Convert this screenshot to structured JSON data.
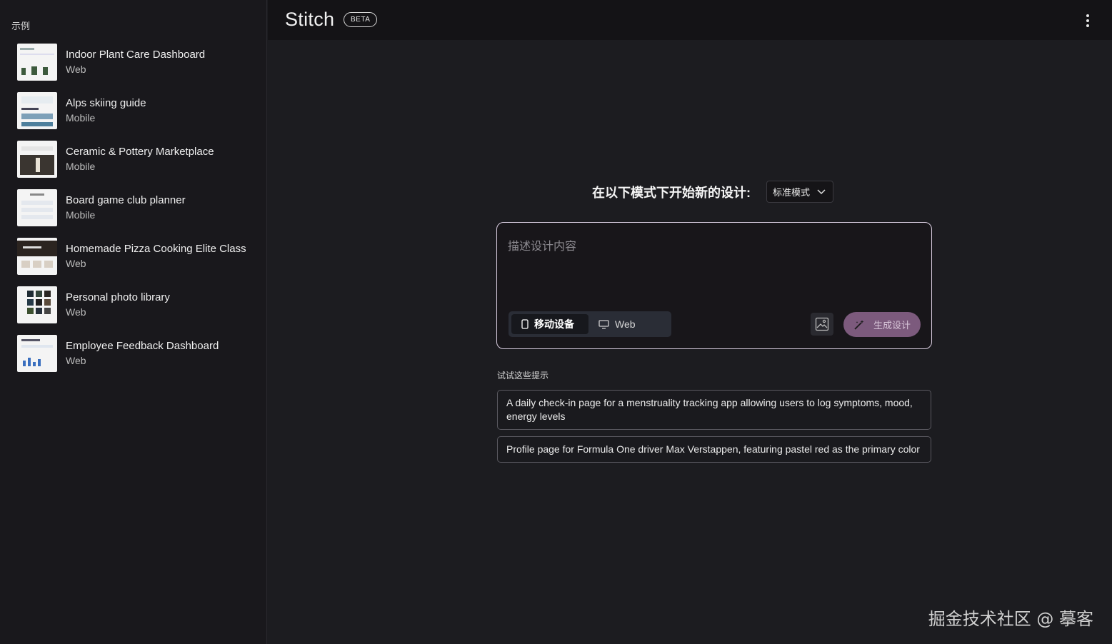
{
  "sidebar": {
    "heading": "示例",
    "items": [
      {
        "title": "Indoor Plant Care Dashboard",
        "type": "Web",
        "thumb": "light-dashboard"
      },
      {
        "title": "Alps skiing guide",
        "type": "Mobile",
        "thumb": "light-mobile"
      },
      {
        "title": "Ceramic & Pottery Marketplace",
        "type": "Mobile",
        "thumb": "dark-hero-mobile"
      },
      {
        "title": "Board game club planner",
        "type": "Mobile",
        "thumb": "light-list"
      },
      {
        "title": "Homemade Pizza Cooking Elite Class",
        "type": "Web",
        "thumb": "dark-banner-web"
      },
      {
        "title": "Personal photo library",
        "type": "Web",
        "thumb": "photo-grid"
      },
      {
        "title": "Employee Feedback Dashboard",
        "type": "Web",
        "thumb": "chart-dashboard"
      }
    ]
  },
  "header": {
    "brand": "Stitch",
    "badge": "BETA",
    "menu_icon": "more-vertical-icon"
  },
  "main": {
    "mode_label": "在以下模式下开始新的设计:",
    "mode_select": "标准模式",
    "prompt_placeholder": "描述设计内容",
    "device_options": [
      {
        "label": "移动设备",
        "icon": "phone-icon",
        "active": true
      },
      {
        "label": "Web",
        "icon": "monitor-icon",
        "active": false
      }
    ],
    "image_icon": "image-icon",
    "generate_label": "生成设计",
    "suggestions_heading": "试试这些提示",
    "suggestions": [
      "A daily check-in page for a menstruality tracking app allowing users to log symptoms, mood, energy levels",
      "Profile page for Formula One driver Max Verstappen, featuring pastel red as the primary color"
    ]
  },
  "watermark": "掘金技术社区 @ 摹客",
  "colors": {
    "accent": "#7c5a7d",
    "background": "#1c1c20",
    "sidebar": "#19181c"
  }
}
